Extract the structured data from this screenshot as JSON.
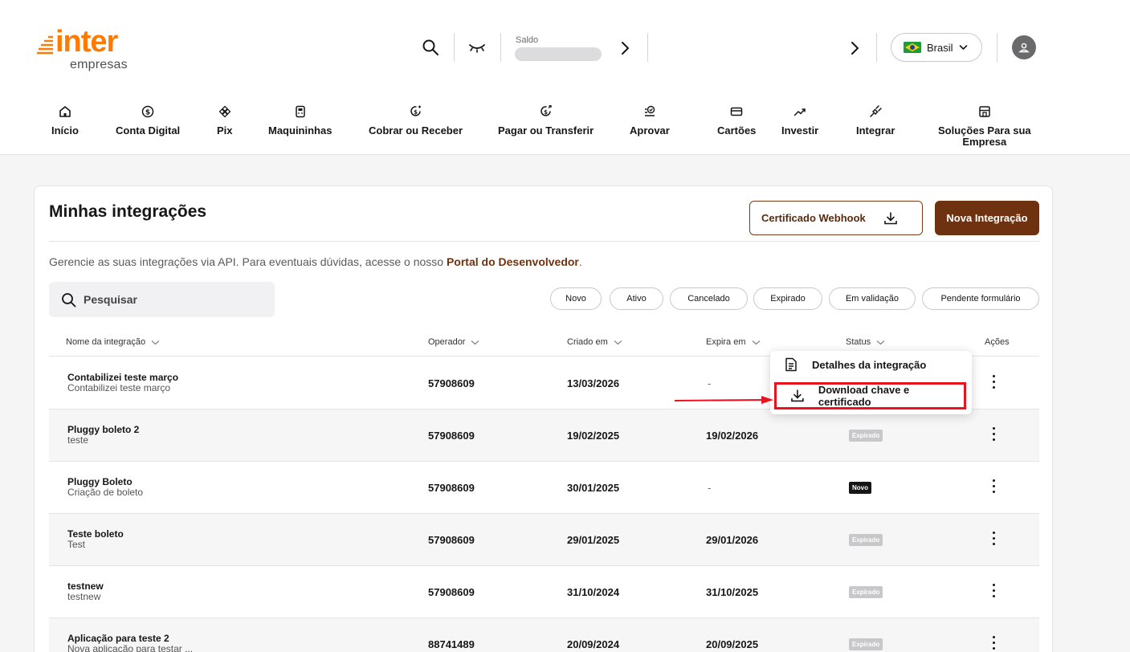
{
  "brand": {
    "name": "inter",
    "sub": "empresas",
    "color": "#ff7a00"
  },
  "header": {
    "saldo_label": "Saldo",
    "country": "Brasil"
  },
  "nav": [
    {
      "label": "Início",
      "icon": "home-icon"
    },
    {
      "label": "Conta Digital",
      "icon": "dollar-circle-icon"
    },
    {
      "label": "Pix",
      "icon": "pix-icon"
    },
    {
      "label": "Maquininhas",
      "icon": "card-machine-icon"
    },
    {
      "label": "Cobrar ou Receber",
      "icon": "receive-icon"
    },
    {
      "label": "Pagar ou Transferir",
      "icon": "pay-icon"
    },
    {
      "label": "Aprovar",
      "icon": "approve-icon"
    },
    {
      "label": "Cartões",
      "icon": "card-icon"
    },
    {
      "label": "Investir",
      "icon": "trend-up-icon"
    },
    {
      "label": "Integrar",
      "icon": "plug-icon"
    },
    {
      "label": "Soluções Para sua",
      "label2": "Empresa",
      "icon": "store-icon"
    }
  ],
  "page": {
    "title": "Minhas integrações",
    "cert_button": "Certificado Webhook",
    "new_button": "Nova Integração",
    "desc": "Gerencie as suas integrações via API. Para eventuais dúvidas, acesse o nosso",
    "desc_link": "Portal do Desenvolvedor",
    "desc_end": ".",
    "search_placeholder": "Pesquisar",
    "filters": [
      "Novo",
      "Ativo",
      "Cancelado",
      "Expirado",
      "Em validação",
      "Pendente formulário"
    ]
  },
  "table": {
    "headers": [
      "Nome da integração",
      "Operador",
      "Criado em",
      "Expira em",
      "Status",
      "Ações"
    ],
    "rows": [
      {
        "name": "Contabilizei teste março",
        "sub": "Contabilizei teste março",
        "operador": "57908609",
        "criado": "13/03/2026",
        "expira": "-",
        "status": ""
      },
      {
        "name": "Pluggy boleto 2",
        "sub": "teste",
        "operador": "57908609",
        "criado": "19/02/2025",
        "expira": "19/02/2026",
        "status": "Expirado"
      },
      {
        "name": "Pluggy Boleto",
        "sub": "Criação de boleto",
        "operador": "57908609",
        "criado": "30/01/2025",
        "expira": "-",
        "status": "Novo"
      },
      {
        "name": "Teste boleto",
        "sub": "Test",
        "operador": "57908609",
        "criado": "29/01/2025",
        "expira": "29/01/2026",
        "status": "Expirado"
      },
      {
        "name": "testnew",
        "sub": "testnew",
        "operador": "57908609",
        "criado": "31/10/2024",
        "expira": "31/10/2025",
        "status": "Expirado"
      },
      {
        "name": "Aplicação para teste 2",
        "sub": "Nova aplicação para testar ...",
        "operador": "88741489",
        "criado": "20/09/2024",
        "expira": "20/09/2025",
        "status": "Expirado"
      }
    ]
  },
  "menu": {
    "details": "Detalhes da integração",
    "download": "Download chave e certificado",
    "highlight_color": "#e8141b"
  }
}
